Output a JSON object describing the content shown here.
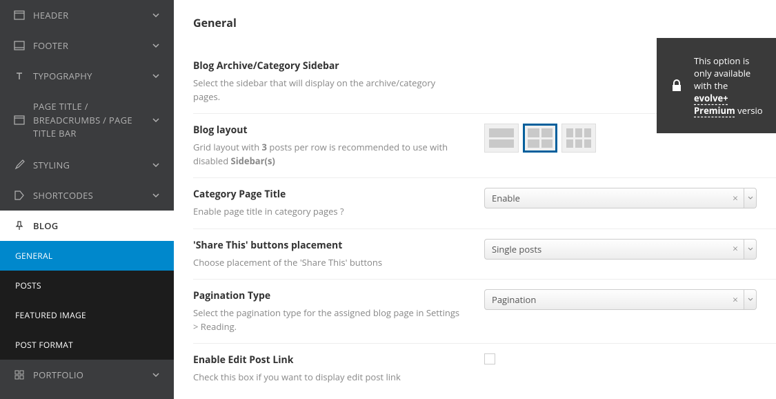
{
  "sidebar": {
    "items": [
      {
        "label": "HEADER"
      },
      {
        "label": "FOOTER"
      },
      {
        "label": "TYPOGRAPHY"
      },
      {
        "label": "PAGE TITLE / BREADCRUMBS / PAGE TITLE BAR"
      },
      {
        "label": "STYLING"
      },
      {
        "label": "SHORTCODES"
      },
      {
        "label": "BLOG"
      },
      {
        "label": "PORTFOLIO"
      }
    ],
    "blog_children": [
      {
        "label": "GENERAL"
      },
      {
        "label": "POSTS"
      },
      {
        "label": "FEATURED IMAGE"
      },
      {
        "label": "POST FORMAT"
      }
    ]
  },
  "page": {
    "title": "General"
  },
  "premium": {
    "text_prefix": "This option is only available with the ",
    "link": "evolve+ Premium",
    "text_suffix": " versio"
  },
  "settings": {
    "sidebar": {
      "title": "Blog Archive/Category Sidebar",
      "desc": "Select the sidebar that will display on the archive/category pages."
    },
    "layout": {
      "title": "Blog layout",
      "desc_pre": "Grid layout with ",
      "desc_bold1": "3",
      "desc_mid": " posts per row is recommended to use with disabled ",
      "desc_bold2": "Sidebar(s)"
    },
    "pagetitle": {
      "title": "Category Page Title",
      "desc": "Enable page title in category pages ?",
      "value": "Enable"
    },
    "share": {
      "title": "'Share This' buttons placement",
      "desc": "Choose placement of the 'Share This' buttons",
      "value": "Single posts"
    },
    "pagination": {
      "title": "Pagination Type",
      "desc": "Select the pagination type for the assigned blog page in Settings > Reading.",
      "value": "Pagination"
    },
    "editlink": {
      "title": "Enable Edit Post Link",
      "desc": "Check this box if you want to display edit post link"
    }
  }
}
